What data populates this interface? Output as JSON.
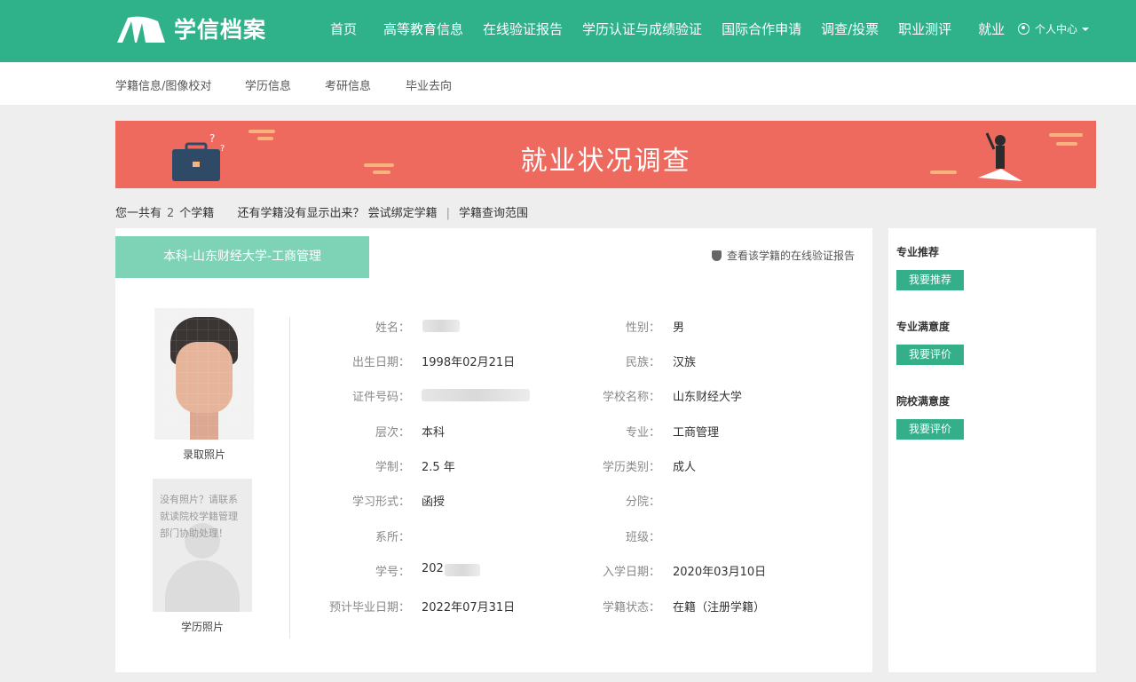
{
  "brand": {
    "name": "学信档案",
    "color": "#2fb28a"
  },
  "nav": {
    "items": [
      "首页",
      "高等教育信息",
      "在线验证报告",
      "学历认证与成绩验证",
      "国际合作申请",
      "调查/投票",
      "职业测评",
      "就业"
    ],
    "user": "个人中心"
  },
  "subnav": {
    "items": [
      "学籍信息/图像校对",
      "学历信息",
      "考研信息",
      "毕业去向"
    ]
  },
  "banner": {
    "title": "就业状况调查",
    "color": "#ee6a5f"
  },
  "info": {
    "prefix": "您一共有",
    "count": "2",
    "suffix": "个学籍",
    "bind_link": "还有学籍没有显示出来？ 尝试绑定学籍",
    "separator": "|",
    "scope_link": "学籍查询范围"
  },
  "record": {
    "tab": "本科-山东财经大学-工商管理",
    "verify_link": "查看该学籍的在线验证报告",
    "photo_caption": "录取照片",
    "nophoto_text": "没有照片？请联系就读院校学籍管理部门协助处理！",
    "nophoto_caption": "学历照片",
    "left_fields": [
      {
        "label": "姓名：",
        "value": ""
      },
      {
        "label": "出生日期：",
        "value": "1998年02月21日"
      },
      {
        "label": "证件号码：",
        "value": ""
      },
      {
        "label": "层次：",
        "value": "本科"
      },
      {
        "label": "学制：",
        "value": "2.5 年"
      },
      {
        "label": "学习形式：",
        "value": "函授"
      },
      {
        "label": "系所：",
        "value": ""
      },
      {
        "label": "学号：",
        "value": "202"
      },
      {
        "label": "预计毕业日期：",
        "value": "2022年07月31日"
      }
    ],
    "right_fields": [
      {
        "label": "性别：",
        "value": "男"
      },
      {
        "label": "民族：",
        "value": "汉族"
      },
      {
        "label": "学校名称：",
        "value": "山东财经大学"
      },
      {
        "label": "专业：",
        "value": "工商管理"
      },
      {
        "label": "学历类别：",
        "value": "成人"
      },
      {
        "label": "分院：",
        "value": ""
      },
      {
        "label": "班级：",
        "value": ""
      },
      {
        "label": "入学日期：",
        "value": "2020年03月10日"
      },
      {
        "label": "学籍状态：",
        "value": "在籍（注册学籍）"
      }
    ]
  },
  "sidebar": {
    "sections": [
      {
        "title": "专业推荐",
        "button": "我要推荐"
      },
      {
        "title": "专业满意度",
        "button": "我要评价"
      },
      {
        "title": "院校满意度",
        "button": "我要评价"
      }
    ],
    "button_color": "#35ae8a"
  }
}
